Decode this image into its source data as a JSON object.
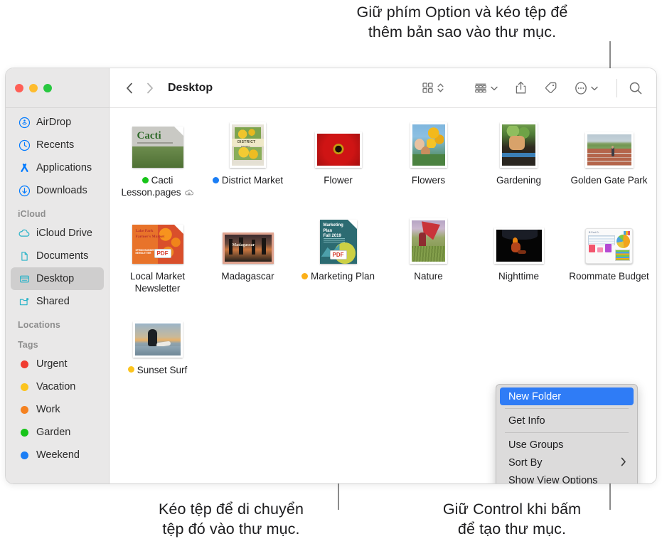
{
  "callouts": {
    "top": "Giữ phím Option và kéo tệp để\nthêm bản sao vào thư mục.",
    "bottom_left": "Kéo tệp để di chuyển\ntệp đó vào thư mục.",
    "bottom_right": "Giữ Control khi bấm\nđể tạo thư mục."
  },
  "window": {
    "title": "Desktop"
  },
  "toolbar": {
    "back_icon": "chevron-left-icon",
    "forward_icon": "chevron-right-icon",
    "title": "Desktop",
    "view_icon": "icon-view-grid-icon",
    "view_stepper_icon": "chevron-up-down-icon",
    "group_icon": "group-by-icon",
    "group_chevron_icon": "chevron-down-icon",
    "share_icon": "share-icon",
    "tag_icon": "tag-icon",
    "more_icon": "ellipsis-circle-icon",
    "more_chevron_icon": "chevron-down-icon",
    "search_icon": "search-icon"
  },
  "sidebar": {
    "favorites": [
      {
        "label": "AirDrop",
        "icon": "airdrop-icon",
        "color": "#007aff"
      },
      {
        "label": "Recents",
        "icon": "clock-icon",
        "color": "#007aff"
      },
      {
        "label": "Applications",
        "icon": "applications-icon",
        "color": "#007aff"
      },
      {
        "label": "Downloads",
        "icon": "download-icon",
        "color": "#007aff"
      }
    ],
    "icloud_header": "iCloud",
    "icloud": [
      {
        "label": "iCloud Drive",
        "icon": "cloud-icon",
        "color": "#2ab3c8",
        "selected": false
      },
      {
        "label": "Documents",
        "icon": "document-icon",
        "color": "#2ab3c8",
        "selected": false
      },
      {
        "label": "Desktop",
        "icon": "desktop-icon",
        "color": "#2ab3c8",
        "selected": true
      },
      {
        "label": "Shared",
        "icon": "shared-folder-icon",
        "color": "#2ab3c8",
        "selected": false
      }
    ],
    "locations_header": "Locations",
    "tags_header": "Tags",
    "tags": [
      {
        "label": "Urgent",
        "color": "#f03b30"
      },
      {
        "label": "Vacation",
        "color": "#fcc41e"
      },
      {
        "label": "Work",
        "color": "#f58220"
      },
      {
        "label": "Garden",
        "color": "#17c419"
      },
      {
        "label": "Weekend",
        "color": "#1b7ef5"
      }
    ]
  },
  "files": {
    "rows": [
      [
        {
          "name": "Cacti\nLesson.pages",
          "tag_color": "#17c419",
          "cloud_badge": true,
          "kind": "pages-doc"
        },
        {
          "name": "District Market",
          "tag_color": "#1b7ef5",
          "cloud_badge": false,
          "kind": "photo-market"
        },
        {
          "name": "Flower",
          "tag_color": null,
          "cloud_badge": false,
          "kind": "photo-flower"
        },
        {
          "name": "Flowers",
          "tag_color": null,
          "cloud_badge": false,
          "kind": "photo-flowers"
        },
        {
          "name": "Gardening",
          "tag_color": null,
          "cloud_badge": false,
          "kind": "photo-gardening"
        },
        {
          "name": "Golden Gate Park",
          "tag_color": null,
          "cloud_badge": false,
          "kind": "photo-park"
        }
      ],
      [
        {
          "name": "Local Market\nNewsletter",
          "tag_color": null,
          "cloud_badge": false,
          "kind": "pdf-newsletter"
        },
        {
          "name": "Madagascar",
          "tag_color": null,
          "cloud_badge": false,
          "kind": "photo-madagascar"
        },
        {
          "name": "Marketing Plan",
          "tag_color": "#fcb018",
          "cloud_badge": false,
          "kind": "pdf-marketing"
        },
        {
          "name": "Nature",
          "tag_color": null,
          "cloud_badge": false,
          "kind": "photo-nature"
        },
        {
          "name": "Nighttime",
          "tag_color": null,
          "cloud_badge": false,
          "kind": "photo-night"
        },
        {
          "name": "Roommate\nBudget",
          "tag_color": null,
          "cloud_badge": false,
          "kind": "numbers-doc"
        }
      ],
      [
        {
          "name": "Sunset Surf",
          "tag_color": "#fcc41e",
          "cloud_badge": false,
          "kind": "photo-sunset"
        }
      ]
    ]
  },
  "context_menu": {
    "items": [
      {
        "label": "New Folder",
        "highlighted": true,
        "submenu": false,
        "separator_after": true
      },
      {
        "label": "Get Info",
        "highlighted": false,
        "submenu": false,
        "separator_after": true
      },
      {
        "label": "Use Groups",
        "highlighted": false,
        "submenu": false,
        "separator_after": false
      },
      {
        "label": "Sort By",
        "highlighted": false,
        "submenu": true,
        "separator_after": false
      },
      {
        "label": "Show View Options",
        "highlighted": false,
        "submenu": false,
        "separator_after": false
      }
    ],
    "submenu_arrow": "chevron-right-icon"
  }
}
